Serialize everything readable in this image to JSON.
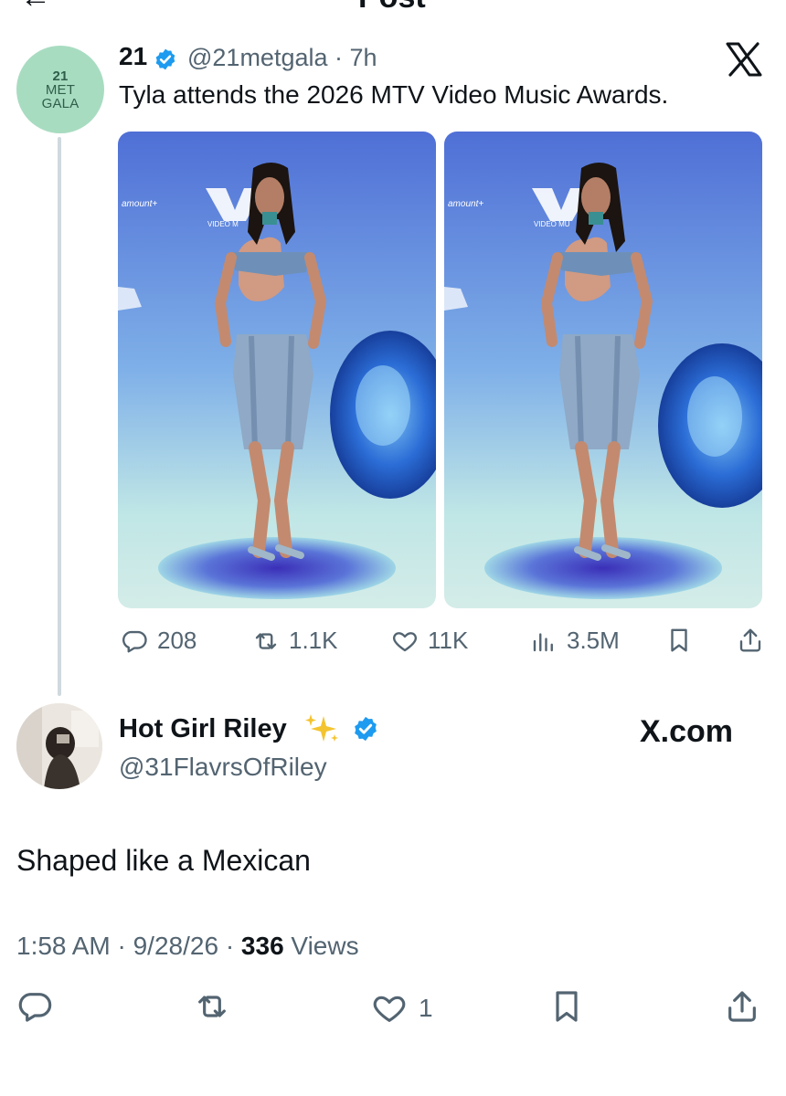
{
  "header": {
    "title": "Post",
    "back_icon": "back-arrow-icon"
  },
  "original_post": {
    "avatar_text": [
      "21",
      "MET",
      "GALA"
    ],
    "display_name": "21",
    "handle_time": "@21metgala · 7h",
    "text": "Tyla attends the 2026 MTV Video Music Awards.",
    "stats": {
      "replies": "208",
      "reposts": "1.1K",
      "likes": "11K",
      "views": "3.5M"
    }
  },
  "reply_post": {
    "display_name": "Hot Girl Riley",
    "handle": "@31FlavrsOfRiley",
    "source": "X.com",
    "text": "Shaped like a Mexican",
    "time": "1:58 AM · 9/28/26 · ",
    "views_count": "336",
    "views_label": " Views",
    "likes": "1"
  },
  "colors": {
    "verified": "#1d9bf0",
    "secondary_text": "#536471",
    "avatar_bg": "#a8dcc1",
    "backdrop_blue": "#5a7fd8",
    "sparkle": "#f4c430"
  }
}
